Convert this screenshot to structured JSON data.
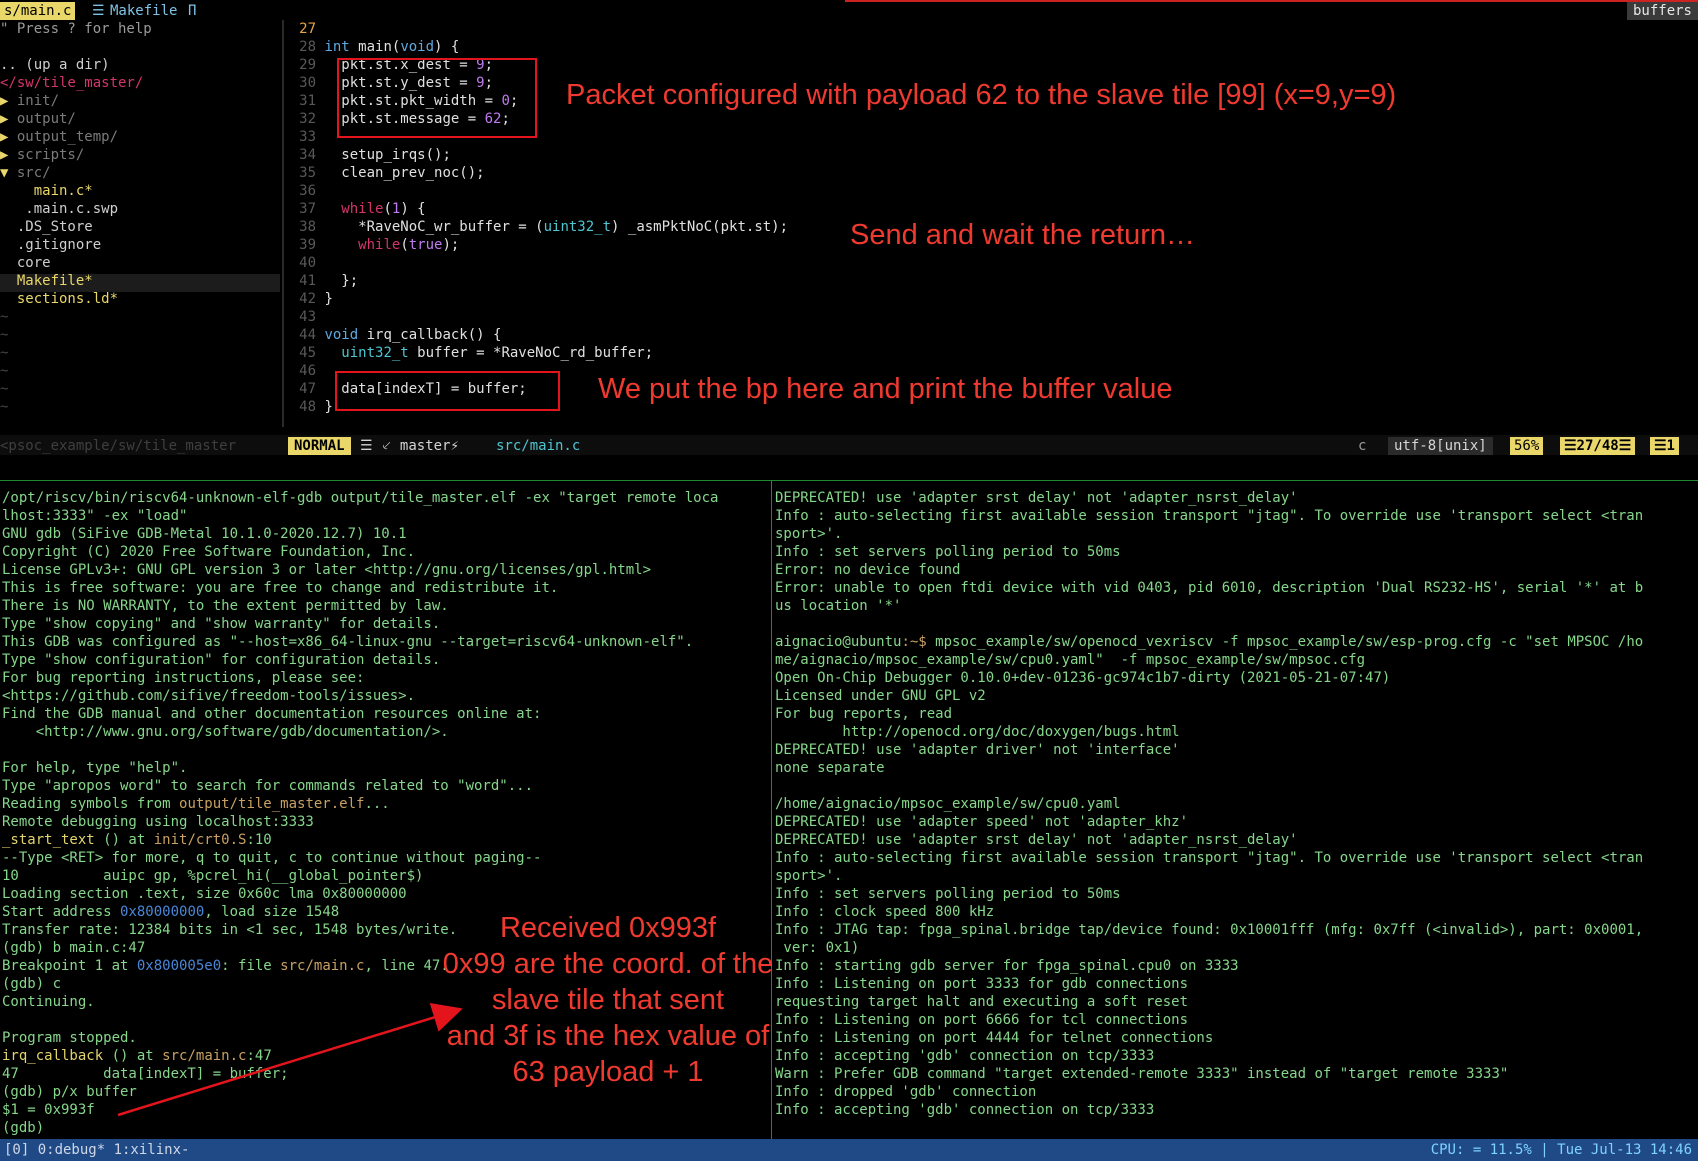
{
  "tabs": {
    "active": "s/main.c",
    "active_icon": "☰",
    "other": "Makefile",
    "other_flag": "Π",
    "right": "buffers"
  },
  "tree": {
    "help": "\" Press ? for help",
    "up": ".. (up a dir)",
    "root": "</sw/tile_master/",
    "items": [
      {
        "arrow": "▶",
        "name": "init/"
      },
      {
        "arrow": "▶",
        "name": "output/"
      },
      {
        "arrow": "▶",
        "name": "output_temp/"
      },
      {
        "arrow": "▶",
        "name": "scripts/"
      },
      {
        "arrow": "▼",
        "name": "src/"
      }
    ],
    "src_files": [
      "main.c*",
      ".main.c.swp"
    ],
    "files": [
      ".DS_Store",
      ".gitignore",
      "core",
      "Makefile*",
      "sections.ld*"
    ],
    "tilde": "~"
  },
  "editor": {
    "current_line": "27",
    "lines": [
      {
        "n": "28",
        "parts": [
          [
            "kw",
            "int"
          ],
          [
            "tx",
            " main("
          ],
          [
            "kw",
            "void"
          ],
          [
            "tx",
            ") {"
          ]
        ]
      },
      {
        "n": "29",
        "parts": [
          [
            "tx",
            "  pkt.st.x_dest = "
          ],
          [
            "num",
            "9"
          ],
          [
            "tx",
            ";"
          ]
        ]
      },
      {
        "n": "30",
        "parts": [
          [
            "tx",
            "  pkt.st.y_dest = "
          ],
          [
            "num",
            "9"
          ],
          [
            "tx",
            ";"
          ]
        ]
      },
      {
        "n": "31",
        "parts": [
          [
            "tx",
            "  pkt.st.pkt_width = "
          ],
          [
            "num",
            "0"
          ],
          [
            "tx",
            ";"
          ]
        ]
      },
      {
        "n": "32",
        "parts": [
          [
            "tx",
            "  pkt.st.message = "
          ],
          [
            "num",
            "62"
          ],
          [
            "tx",
            ";"
          ]
        ]
      },
      {
        "n": "33",
        "parts": []
      },
      {
        "n": "34",
        "parts": [
          [
            "tx",
            "  setup_irqs();"
          ]
        ]
      },
      {
        "n": "35",
        "parts": [
          [
            "tx",
            "  clean_prev_noc();"
          ]
        ]
      },
      {
        "n": "36",
        "parts": []
      },
      {
        "n": "37",
        "parts": [
          [
            "tx",
            "  "
          ],
          [
            "ctl",
            "while"
          ],
          [
            "tx",
            "("
          ],
          [
            "num",
            "1"
          ],
          [
            "tx",
            ") {"
          ]
        ]
      },
      {
        "n": "38",
        "parts": [
          [
            "tx",
            "    *RaveNoC_wr_buffer = ("
          ],
          [
            "ty",
            "uint32_t"
          ],
          [
            "tx",
            ") _asmPktNoC(pkt.st);"
          ]
        ]
      },
      {
        "n": "39",
        "parts": [
          [
            "tx",
            "    "
          ],
          [
            "ctl",
            "while"
          ],
          [
            "tx",
            "("
          ],
          [
            "num",
            "true"
          ],
          [
            "tx",
            ");"
          ]
        ]
      },
      {
        "n": "40",
        "parts": []
      },
      {
        "n": "41",
        "parts": [
          [
            "tx",
            "  };"
          ]
        ]
      },
      {
        "n": "42",
        "parts": [
          [
            "tx",
            "}"
          ]
        ]
      },
      {
        "n": "43",
        "parts": []
      },
      {
        "n": "44",
        "parts": [
          [
            "kw",
            "void"
          ],
          [
            "tx",
            " irq_callback() {"
          ]
        ]
      },
      {
        "n": "45",
        "parts": [
          [
            "tx",
            "  "
          ],
          [
            "ty",
            "uint32_t"
          ],
          [
            "tx",
            " buffer = *RaveNoC_rd_buffer;"
          ]
        ]
      },
      {
        "n": "46",
        "parts": []
      },
      {
        "n": "47",
        "parts": [
          [
            "tx",
            "  data[indexT] = buffer;"
          ]
        ]
      },
      {
        "n": "48",
        "parts": [
          [
            "tx",
            "}"
          ]
        ]
      }
    ]
  },
  "annotations": {
    "packet": "Packet configured with payload 62 to the slave tile [99] (x=9,y=9)",
    "send": "Send and wait the return…",
    "bp": "We put the bp here and print the buffer value",
    "received": [
      "Received 0x993f",
      "0x99 are the coord. of the",
      "slave tile that sent",
      "and 3f is the hex value of",
      "63 payload + 1"
    ]
  },
  "status": {
    "path": "<psoc_example/sw/tile_master",
    "mode": "NORMAL",
    "branch": "☰ ⸔ master⚡",
    "file": "src/main.c",
    "filetype": "c",
    "encoding": "utf-8[unix]",
    "percent": "56%",
    "position": "☰27/48☰",
    "warn": "☰1"
  },
  "gdb": {
    "lines": [
      [
        [
          "gr",
          "/opt/riscv/bin/riscv64-unknown-elf-gdb output/tile_master.elf -ex \"target remote loca"
        ]
      ],
      [
        [
          "gr",
          "lhost:3333\" -ex \"load\""
        ]
      ],
      [
        [
          "gr",
          "GNU gdb (SiFive GDB-Metal 10.1.0-2020.12.7) 10.1"
        ]
      ],
      [
        [
          "gr",
          "Copyright (C) 2020 Free Software Foundation, Inc."
        ]
      ],
      [
        [
          "gr",
          "License GPLv3+: GNU GPL version 3 or later <http://gnu.org/licenses/gpl.html>"
        ]
      ],
      [
        [
          "gr",
          "This is free software: you are free to change and redistribute it."
        ]
      ],
      [
        [
          "gr",
          "There is NO WARRANTY, to the extent permitted by law."
        ]
      ],
      [
        [
          "gr",
          "Type \"show copying\" and \"show warranty\" for details."
        ]
      ],
      [
        [
          "gr",
          "This GDB was configured as \"--host=x86_64-linux-gnu --target=riscv64-unknown-elf\"."
        ]
      ],
      [
        [
          "gr",
          "Type \"show configuration\" for configuration details."
        ]
      ],
      [
        [
          "gr",
          "For bug reporting instructions, please see:"
        ]
      ],
      [
        [
          "gr",
          "<https://github.com/sifive/freedom-tools/issues>."
        ]
      ],
      [
        [
          "gr",
          "Find the GDB manual and other documentation resources online at:"
        ]
      ],
      [
        [
          "gr",
          "    <http://www.gnu.org/software/gdb/documentation/>."
        ]
      ],
      [
        [
          "gr",
          ""
        ]
      ],
      [
        [
          "gr",
          "For help, type \"help\"."
        ]
      ],
      [
        [
          "gr",
          "Type \"apropos word\" to search for commands related to \"word\"..."
        ]
      ],
      [
        [
          "gr",
          "Reading symbols from "
        ],
        [
          "tan",
          "output/tile_master.elf"
        ],
        [
          "gr",
          "..."
        ]
      ],
      [
        [
          "gr",
          "Remote debugging using localhost:3333"
        ]
      ],
      [
        [
          "ylw",
          "_start_text"
        ],
        [
          "gr",
          " () at "
        ],
        [
          "tan",
          "init/crt0.S"
        ],
        [
          "gr",
          ":10"
        ]
      ],
      [
        [
          "gr",
          "--Type <RET> for more, q to quit, c to continue without paging--"
        ]
      ],
      [
        [
          "gr",
          "10          auipc gp, %pcrel_hi(__global_pointer$)"
        ]
      ],
      [
        [
          "gr",
          "Loading section .text, size 0x60c lma 0x80000000"
        ]
      ],
      [
        [
          "gr",
          "Start address "
        ],
        [
          "blue",
          "0x80000000"
        ],
        [
          "gr",
          ", load size 1548"
        ]
      ],
      [
        [
          "gr",
          "Transfer rate: 12384 bits in <1 sec, 1548 bytes/write."
        ]
      ],
      [
        [
          "gr",
          "(gdb) b main.c:47"
        ]
      ],
      [
        [
          "gr",
          "Breakpoint 1 at "
        ],
        [
          "blue",
          "0x800005e0"
        ],
        [
          "gr",
          ": file "
        ],
        [
          "tan",
          "src/main.c"
        ],
        [
          "gr",
          ", line 47."
        ]
      ],
      [
        [
          "gr",
          "(gdb) c"
        ]
      ],
      [
        [
          "gr",
          "Continuing."
        ]
      ],
      [
        [
          "gr",
          ""
        ]
      ],
      [
        [
          "gr",
          "Program stopped."
        ]
      ],
      [
        [
          "ylw",
          "irq_callback"
        ],
        [
          "gr",
          " () at "
        ],
        [
          "tan",
          "src/main.c"
        ],
        [
          "gr",
          ":47"
        ]
      ],
      [
        [
          "gr",
          "47          data[indexT] = buffer;"
        ]
      ],
      [
        [
          "gr",
          "(gdb) p/x buffer"
        ]
      ],
      [
        [
          "gr",
          "$1 = 0x993f"
        ]
      ],
      [
        [
          "gr",
          "(gdb)"
        ]
      ]
    ]
  },
  "openocd": {
    "lines": [
      [
        [
          "gr",
          "DEPRECATED! use 'adapter srst delay' not 'adapter_nsrst_delay'"
        ]
      ],
      [
        [
          "gr",
          "Info : auto-selecting first available session transport \"jtag\". To override use 'transport select <tran"
        ]
      ],
      [
        [
          "gr",
          "sport>'."
        ]
      ],
      [
        [
          "gr",
          "Info : set servers polling period to 50ms"
        ]
      ],
      [
        [
          "gr",
          "Error: no device found"
        ]
      ],
      [
        [
          "gr",
          "Error: unable to open ftdi device with vid 0403, pid 6010, description 'Dual RS232-HS', serial '*' at b"
        ]
      ],
      [
        [
          "gr",
          "us location '*'"
        ]
      ],
      [
        [
          "gr",
          ""
        ]
      ],
      [
        [
          "gr",
          "aignacio@ubuntu"
        ],
        [
          "tan",
          ":~$"
        ],
        [
          "gr",
          " mpsoc_example/sw/openocd_vexriscv -f mpsoc_example/sw/esp-prog.cfg -c \"set MPSOC /ho"
        ]
      ],
      [
        [
          "gr",
          "me/aignacio/mpsoc_example/sw/cpu0.yaml\"  -f mpsoc_example/sw/mpsoc.cfg"
        ]
      ],
      [
        [
          "gr",
          "Open On-Chip Debugger 0.10.0+dev-01236-gc974c1b7-dirty (2021-05-21-07:47)"
        ]
      ],
      [
        [
          "gr",
          "Licensed under GNU GPL v2"
        ]
      ],
      [
        [
          "gr",
          "For bug reports, read"
        ]
      ],
      [
        [
          "gr",
          "        http://openocd.org/doc/doxygen/bugs.html"
        ]
      ],
      [
        [
          "gr",
          "DEPRECATED! use 'adapter driver' not 'interface'"
        ]
      ],
      [
        [
          "gr",
          "none separate"
        ]
      ],
      [
        [
          "gr",
          ""
        ]
      ],
      [
        [
          "gr",
          "/home/aignacio/mpsoc_example/sw/cpu0.yaml"
        ]
      ],
      [
        [
          "gr",
          "DEPRECATED! use 'adapter speed' not 'adapter_khz'"
        ]
      ],
      [
        [
          "gr",
          "DEPRECATED! use 'adapter srst delay' not 'adapter_nsrst_delay'"
        ]
      ],
      [
        [
          "gr",
          "Info : auto-selecting first available session transport \"jtag\". To override use 'transport select <tran"
        ]
      ],
      [
        [
          "gr",
          "sport>'."
        ]
      ],
      [
        [
          "gr",
          "Info : set servers polling period to 50ms"
        ]
      ],
      [
        [
          "gr",
          "Info : clock speed 800 kHz"
        ]
      ],
      [
        [
          "gr",
          "Info : JTAG tap: fpga_spinal.bridge tap/device found: 0x10001fff (mfg: 0x7ff (<invalid>), part: 0x0001,"
        ]
      ],
      [
        [
          "gr",
          " ver: 0x1)"
        ]
      ],
      [
        [
          "gr",
          "Info : starting gdb server for fpga_spinal.cpu0 on 3333"
        ]
      ],
      [
        [
          "gr",
          "Info : Listening on port 3333 for gdb connections"
        ]
      ],
      [
        [
          "gr",
          "requesting target halt and executing a soft reset"
        ]
      ],
      [
        [
          "gr",
          "Info : Listening on port 6666 for tcl connections"
        ]
      ],
      [
        [
          "gr",
          "Info : Listening on port 4444 for telnet connections"
        ]
      ],
      [
        [
          "gr",
          "Info : accepting 'gdb' connection on tcp/3333"
        ]
      ],
      [
        [
          "gr",
          "Warn : Prefer GDB command \"target extended-remote 3333\" instead of \"target remote 3333\""
        ]
      ],
      [
        [
          "gr",
          "Info : dropped 'gdb' connection"
        ]
      ],
      [
        [
          "gr",
          "Info : accepting 'gdb' connection on tcp/3333"
        ]
      ]
    ]
  },
  "tmux": {
    "left": "[0] 0:debug* 1:xilinx-",
    "right": "CPU: = 11.5% | Tue Jul-13 14:46"
  }
}
